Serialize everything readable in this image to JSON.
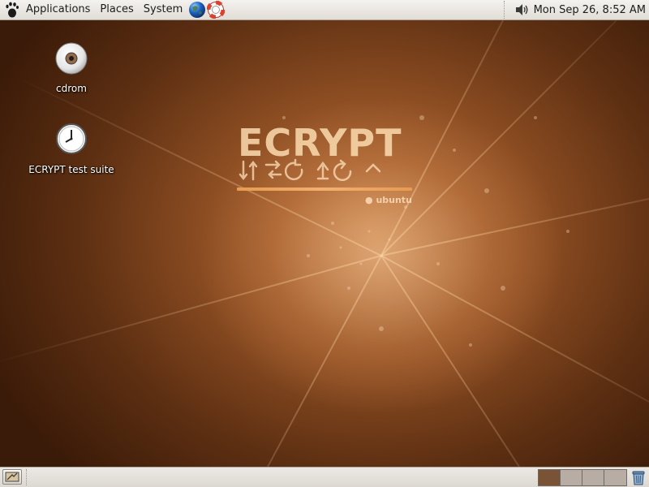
{
  "top_panel": {
    "menus": {
      "applications": "Applications",
      "places": "Places",
      "system": "System"
    },
    "launchers": [
      "web-browser-icon",
      "help-icon"
    ],
    "clock": "Mon Sep 26,  8:52 AM"
  },
  "desktop": {
    "icons": [
      {
        "label": "cdrom",
        "icon": "cdrom-icon"
      },
      {
        "label": "ECRYPT test suite",
        "icon": "clock-icon"
      }
    ],
    "wallpaper": {
      "title": "ECRYPT",
      "brand": "ubuntu"
    }
  },
  "bottom_panel": {
    "workspaces": [
      {
        "name": "workspace-1",
        "active": true
      },
      {
        "name": "workspace-2",
        "active": false
      },
      {
        "name": "workspace-3",
        "active": false
      },
      {
        "name": "workspace-4",
        "active": false
      }
    ]
  },
  "colors": {
    "wallpaper_dark": "#3a1a08",
    "wallpaper_light": "#b9733e",
    "accent_bar": "#e89a50",
    "panel": "#e6e3de"
  }
}
